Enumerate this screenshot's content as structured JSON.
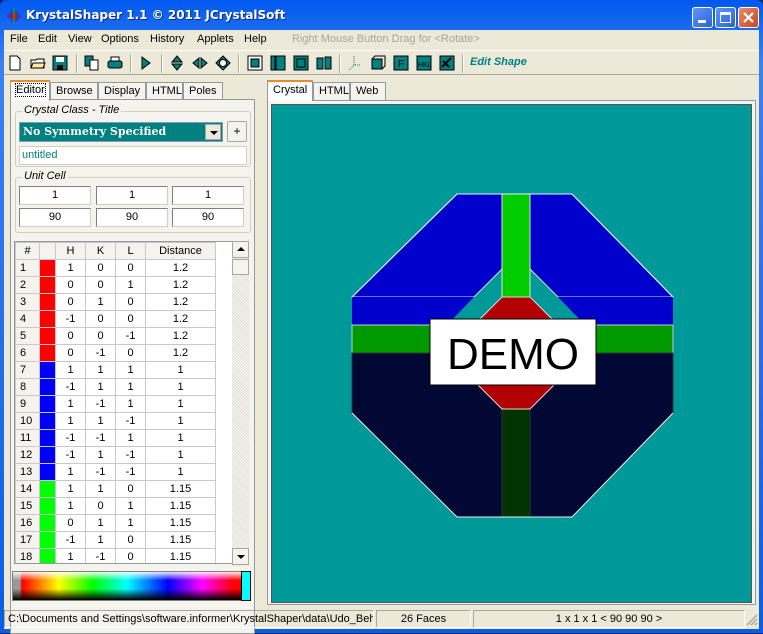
{
  "window": {
    "title": "KrystalShaper 1.1   © 2011 JCrystalSoft",
    "controls": [
      "minimize",
      "maximize",
      "close"
    ]
  },
  "menubar": {
    "items": [
      "File",
      "Edit",
      "View",
      "Options",
      "History",
      "Applets",
      "Help"
    ],
    "hint": "Right Mouse Button Drag for <Rotate>"
  },
  "toolbar": {
    "buttons": [
      "new-icon",
      "open-icon",
      "save-icon",
      "copy-icon",
      "print-icon",
      "play-icon",
      "rotate-vertical-icon",
      "rotate-horizontal-icon",
      "rotate-circular-icon",
      "view-front-icon",
      "view-side-icon",
      "view-top-icon",
      "view-split-icon",
      "axes-icon",
      "cube-icon",
      "faces-icon",
      "hkl-icon",
      "edit-icon"
    ],
    "edit_shape_label": "Edit Shape"
  },
  "left_tabs": [
    "Editor",
    "Browse",
    "Display",
    "HTML",
    "Poles"
  ],
  "editor": {
    "crystal_class_label": "Crystal Class - Title",
    "crystal_class_value": "No Symmetry Specified",
    "plus_label": "+",
    "title_value": "untitled",
    "unit_cell_label": "Unit Cell",
    "unit_cell": {
      "lengths": [
        "1",
        "1",
        "1"
      ],
      "angles": [
        "90",
        "90",
        "90"
      ]
    }
  },
  "faces_table": {
    "headers": [
      "#",
      "",
      "H",
      "K",
      "L",
      "Distance"
    ],
    "rows": [
      {
        "n": "1",
        "color": "#ff0000",
        "h": "1",
        "k": "0",
        "l": "0",
        "d": "1.2"
      },
      {
        "n": "2",
        "color": "#ff0000",
        "h": "0",
        "k": "0",
        "l": "1",
        "d": "1.2"
      },
      {
        "n": "3",
        "color": "#ff0000",
        "h": "0",
        "k": "1",
        "l": "0",
        "d": "1.2"
      },
      {
        "n": "4",
        "color": "#ff0000",
        "h": "-1",
        "k": "0",
        "l": "0",
        "d": "1.2"
      },
      {
        "n": "5",
        "color": "#ff0000",
        "h": "0",
        "k": "0",
        "l": "-1",
        "d": "1.2"
      },
      {
        "n": "6",
        "color": "#ff0000",
        "h": "0",
        "k": "-1",
        "l": "0",
        "d": "1.2"
      },
      {
        "n": "7",
        "color": "#0000ff",
        "h": "1",
        "k": "1",
        "l": "1",
        "d": "1"
      },
      {
        "n": "8",
        "color": "#0000ff",
        "h": "-1",
        "k": "1",
        "l": "1",
        "d": "1"
      },
      {
        "n": "9",
        "color": "#0000ff",
        "h": "1",
        "k": "-1",
        "l": "1",
        "d": "1"
      },
      {
        "n": "10",
        "color": "#0000ff",
        "h": "1",
        "k": "1",
        "l": "-1",
        "d": "1"
      },
      {
        "n": "11",
        "color": "#0000ff",
        "h": "-1",
        "k": "-1",
        "l": "1",
        "d": "1"
      },
      {
        "n": "12",
        "color": "#0000ff",
        "h": "-1",
        "k": "1",
        "l": "-1",
        "d": "1"
      },
      {
        "n": "13",
        "color": "#0000ff",
        "h": "1",
        "k": "-1",
        "l": "-1",
        "d": "1"
      },
      {
        "n": "14",
        "color": "#00ff00",
        "h": "1",
        "k": "1",
        "l": "0",
        "d": "1.15"
      },
      {
        "n": "15",
        "color": "#00ff00",
        "h": "1",
        "k": "0",
        "l": "1",
        "d": "1.15"
      },
      {
        "n": "16",
        "color": "#00ff00",
        "h": "0",
        "k": "1",
        "l": "1",
        "d": "1.15"
      },
      {
        "n": "17",
        "color": "#00ff00",
        "h": "-1",
        "k": "1",
        "l": "0",
        "d": "1.15"
      },
      {
        "n": "18",
        "color": "#00ff00",
        "h": "1",
        "k": "-1",
        "l": "0",
        "d": "1.15"
      }
    ]
  },
  "palette": {
    "selected_color": "#00ffff"
  },
  "right_tabs": [
    "Crystal",
    "HTML",
    "Web"
  ],
  "viewport": {
    "background": "#009999",
    "watermark": "DEMO",
    "face_colors": {
      "upper": "#0000cc",
      "lower": "#000833",
      "green_light": "#00cc00",
      "green_mid": "#009900",
      "green_dark": "#003300",
      "red": "#b30000"
    }
  },
  "status": {
    "path": "C:\\Documents and Settings\\software.informer\\KrystalShaper\\data\\Udo_Beh",
    "faces": "26 Faces",
    "cell": "1 x 1 x 1 < 90 90 90 >"
  }
}
